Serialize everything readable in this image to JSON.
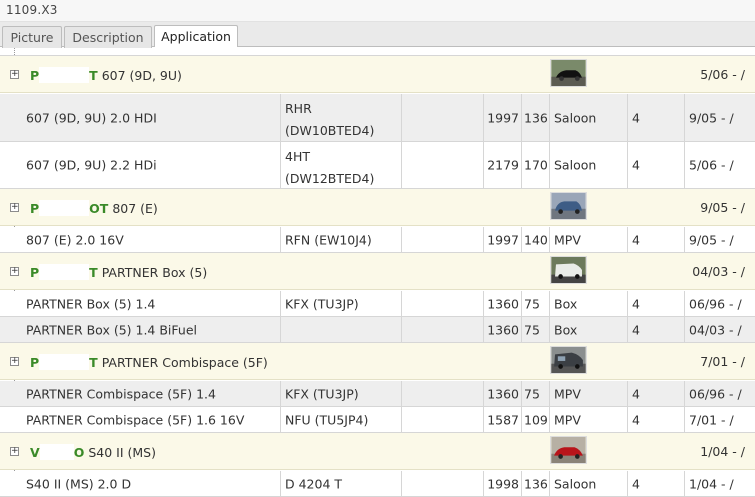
{
  "window": {
    "title": "1109.X3"
  },
  "tabs": [
    {
      "label": "Picture",
      "active": false
    },
    {
      "label": "Description",
      "active": false
    },
    {
      "label": "Application",
      "active": true
    }
  ],
  "groups": [
    {
      "brand_start": "P",
      "brand_end": "T",
      "model": "607 (9D, 9U)",
      "date": "5/06 - /",
      "thumbnail": "car-thumbnail-black-sedan",
      "rows": [
        {
          "name": "607 (9D, 9U) 2.0 HDI",
          "engine_line1": "RHR",
          "engine_line2": "(DW10BTED4)",
          "cc": "1997",
          "kw": "136",
          "body": "Saloon",
          "doors": "4",
          "from": "9/05 - /"
        },
        {
          "name": "607 (9D, 9U) 2.2 HDi",
          "engine_line1": "4HT",
          "engine_line2": "(DW12BTED4)",
          "cc": "2179",
          "kw": "170",
          "body": "Saloon",
          "doors": "4",
          "from": "5/06 - /"
        }
      ]
    },
    {
      "brand_start": "P",
      "brand_end": "OT",
      "model": "807 (E)",
      "date": "9/05 - /",
      "thumbnail": "car-thumbnail-blue-mpv",
      "rows": [
        {
          "name": "807 (E) 2.0 16V",
          "engine_line1": "RFN (EW10J4)",
          "cc": "1997",
          "kw": "140",
          "body": "MPV",
          "doors": "4",
          "from": "9/05 - /"
        }
      ]
    },
    {
      "brand_start": "P",
      "brand_end": "T",
      "model": "PARTNER Box (5)",
      "date": "04/03 - /",
      "thumbnail": "car-thumbnail-white-van",
      "rows": [
        {
          "name": "PARTNER Box (5) 1.4",
          "engine_line1": "KFX (TU3JP)",
          "cc": "1360",
          "kw": "75",
          "body": "Box",
          "doors": "4",
          "from": "06/96 - /"
        },
        {
          "name": "PARTNER Box (5) 1.4 BiFuel",
          "engine_line1": "",
          "cc": "1360",
          "kw": "75",
          "body": "Box",
          "doors": "4",
          "from": "04/03 - /"
        }
      ]
    },
    {
      "brand_start": "P",
      "brand_end": "T",
      "model": "PARTNER Combispace (5F)",
      "date": "7/01 - /",
      "thumbnail": "car-thumbnail-dark-mpv",
      "rows": [
        {
          "name": "PARTNER Combispace (5F) 1.4",
          "engine_line1": "KFX (TU3JP)",
          "cc": "1360",
          "kw": "75",
          "body": "MPV",
          "doors": "4",
          "from": "06/96 - /"
        },
        {
          "name": "PARTNER Combispace (5F) 1.6 16V",
          "engine_line1": "NFU (TU5JP4)",
          "cc": "1587",
          "kw": "109",
          "body": "MPV",
          "doors": "4",
          "from": "7/01 - /"
        }
      ]
    },
    {
      "brand_start": "V",
      "brand_end": "O",
      "model": "S40 II (MS)",
      "date": "1/04 - /",
      "thumbnail": "car-thumbnail-red-sedan",
      "rows": [
        {
          "name": "S40 II (MS) 2.0 D",
          "engine_line1": "D 4204 T",
          "cc": "1998",
          "kw": "136",
          "body": "Saloon",
          "doors": "4",
          "from": "1/04 - /"
        }
      ]
    }
  ],
  "colors": {
    "group_bg": "#fbf9e8",
    "brand_green": "#3a8a28",
    "row_alt": "#eeeeee"
  },
  "icons": {
    "expander": "plus-box-icon"
  }
}
